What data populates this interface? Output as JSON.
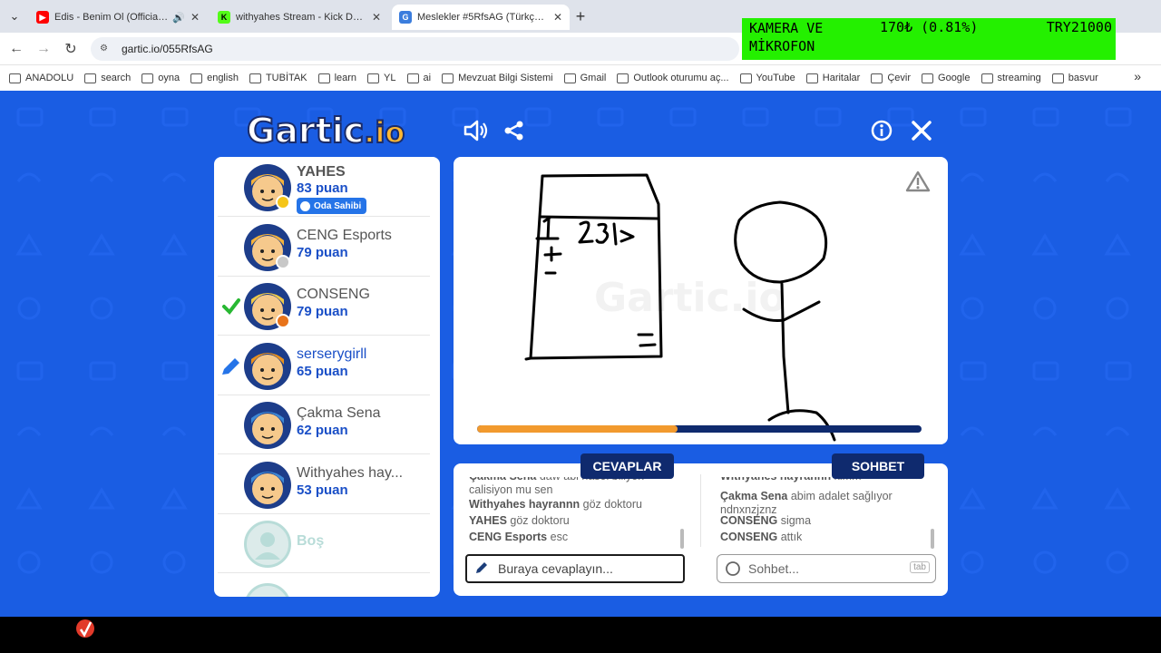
{
  "browser": {
    "tabs": [
      {
        "title": "Edis - Benim Ol (Official Vid",
        "favicon": "youtube-icon",
        "color": "#ff0000"
      },
      {
        "title": "withyahes Stream - Kick Dashbo",
        "favicon": "kick-icon",
        "color": "#53fc18"
      },
      {
        "title": "Meslekler #5RfsAG (Türkçe) - G",
        "favicon": "gartic-icon",
        "color": "#3b7ddd"
      }
    ],
    "url": "gartic.io/055RfsAG",
    "bookmarks": [
      "ANADOLU",
      "search",
      "oyna",
      "english",
      "TUBİTAK",
      "learn",
      "YL",
      "ai",
      "Mevzuat Bilgi Sistemi",
      "Gmail",
      "Outlook oturumu aç...",
      "YouTube",
      "Haritalar",
      "Çevir",
      "Google",
      "streaming",
      "basvur"
    ]
  },
  "overlay": {
    "line1": "KAMERA VE",
    "line2": "MİKROFON",
    "amount": "170₺ (0.81%)",
    "goal": "TRY21000"
  },
  "game": {
    "logo": "Gartic",
    "logo_suffix": ".io",
    "watermark": "Gartic.io",
    "players": [
      {
        "name": "YAHES",
        "points": "83 puan",
        "badge": "Oda Sahibi",
        "status": "yellow"
      },
      {
        "name": "CENG Esports",
        "points": "79 puan",
        "status": "gray"
      },
      {
        "name": "CONSENG",
        "points": "79 puan",
        "status": "orange",
        "marker": "check"
      },
      {
        "name": "serserygirll",
        "points": "65 puan",
        "marker": "pencil"
      },
      {
        "name": "Çakma Sena",
        "points": "62 puan"
      },
      {
        "name": "Withyahes hay...",
        "points": "53 puan"
      },
      {
        "name": "Boş",
        "points": ""
      }
    ],
    "timer_fraction": 0.45,
    "answers_label": "CEVAPLAR",
    "chat_label": "SOHBET",
    "answers": [
      {
        "user": "Çakma Sena",
        "text": "daw abi nasol biliyon calisiyon mu sen"
      },
      {
        "user": "Withyahes hayrannn",
        "text": "göz doktoru"
      },
      {
        "user": "YAHES",
        "text": "göz doktoru"
      },
      {
        "user": "CENG Esports",
        "text": "esc"
      }
    ],
    "chat": [
      {
        "user": "Withyahes hayrannn",
        "text": "kimm"
      },
      {
        "user": "Çakma Sena",
        "text": "abim adalet sağlıyor ndnxnzjznz"
      },
      {
        "user": "CONSENG",
        "text": "sigma"
      },
      {
        "user": "CONSENG",
        "text": "attık"
      }
    ],
    "answer_placeholder": "Buraya cevaplayın...",
    "chat_placeholder": "Sohbet...",
    "tab_hint": "tab"
  }
}
